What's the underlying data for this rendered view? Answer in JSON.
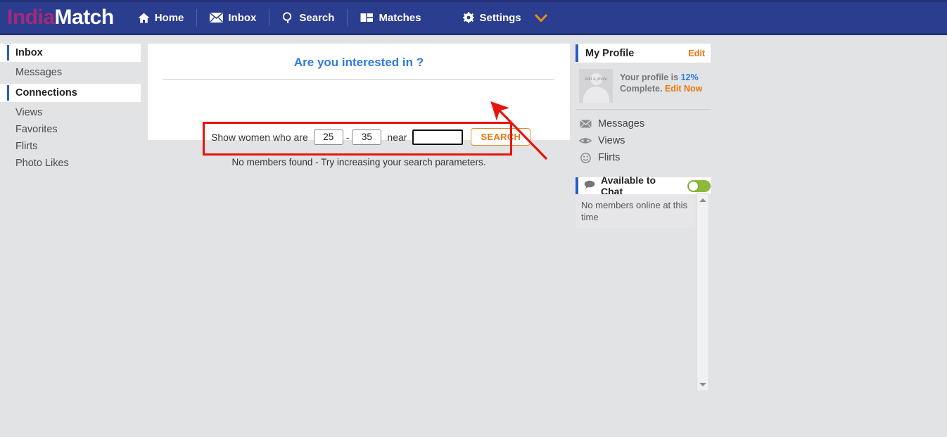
{
  "header": {
    "logo_first": "India",
    "logo_second": "Match",
    "logo_color_first": "#a52a7a",
    "logo_color_second": "#ffffff",
    "background": "#2b3d8e",
    "nav": [
      {
        "label": "Home",
        "icon": "home-icon"
      },
      {
        "label": "Inbox",
        "icon": "envelope-icon"
      },
      {
        "label": "Search",
        "icon": "magnifier-icon"
      },
      {
        "label": "Matches",
        "icon": "cards-icon"
      },
      {
        "label": "Settings",
        "icon": "gear-icon",
        "chevron": "chevron-down-icon",
        "chevron_color": "#ec8b1c"
      }
    ]
  },
  "sidebar": {
    "groups": [
      {
        "header": "Inbox",
        "items": [
          "Messages"
        ]
      },
      {
        "header": "Connections",
        "items": [
          "Views",
          "Favorites",
          "Flirts",
          "Photo Likes"
        ]
      }
    ]
  },
  "main": {
    "title": "Are you interested in ?",
    "title_color": "#2d7ae5",
    "form": {
      "prefix_label": "Show women who are",
      "age_min": "25",
      "separator": "-",
      "age_max": "35",
      "near_label": "near",
      "near_value": "",
      "near_placeholder": "",
      "search_button": "SEARCH",
      "search_button_color": "#e8780c"
    },
    "result_message": "No members found - Try increasing your search parameters."
  },
  "annotation": {
    "box_color": "#e8140c",
    "arrow_color": "#e8140c",
    "target": "search-button"
  },
  "right": {
    "profile": {
      "panel_title": "My Profile",
      "edit_label": "Edit",
      "avatar_placeholder": "Add a photo",
      "status_prefix": "Your profile is",
      "percent": "12%",
      "status_suffix": "Complete.",
      "edit_now_label": "Edit Now"
    },
    "quick_links": [
      {
        "label": "Messages",
        "icon": "envelope-icon"
      },
      {
        "label": "Views",
        "icon": "eye-icon"
      },
      {
        "label": "Flirts",
        "icon": "wink-face-icon"
      }
    ],
    "chat": {
      "panel_title": "Available to Chat",
      "bubble_icon": "chat-bubble-icon",
      "toggle_state": "on",
      "toggle_color": "#8cb83c",
      "empty_message": "No members online at this time"
    }
  }
}
